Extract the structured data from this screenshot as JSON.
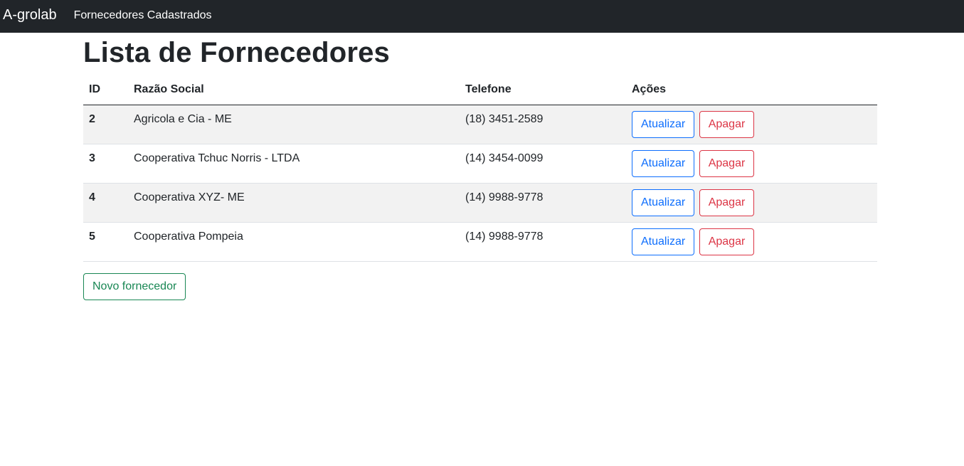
{
  "navbar": {
    "brand": "A-grolab",
    "link": "Fornecedores Cadastrados"
  },
  "page": {
    "title": "Lista de Fornecedores"
  },
  "table": {
    "headers": [
      "ID",
      "Razão Social",
      "Telefone",
      "Ações"
    ],
    "rows": [
      {
        "id": "2",
        "razao": "Agricola e Cia - ME",
        "telefone": "(18) 3451-2589"
      },
      {
        "id": "3",
        "razao": "Cooperativa Tchuc Norris - LTDA",
        "telefone": "(14) 3454-0099"
      },
      {
        "id": "4",
        "razao": "Cooperativa XYZ- ME",
        "telefone": "(14) 9988-9778"
      },
      {
        "id": "5",
        "razao": "Cooperativa Pompeia",
        "telefone": "(14) 9988-9778"
      }
    ],
    "update_label": "Atualizar",
    "delete_label": "Apagar"
  },
  "actions": {
    "new_label": "Novo fornecedor"
  },
  "colors": {
    "navbar_bg": "#212529",
    "primary": "#0d6efd",
    "danger": "#dc3545",
    "success": "#198754",
    "striped_row": "#f2f2f2"
  }
}
